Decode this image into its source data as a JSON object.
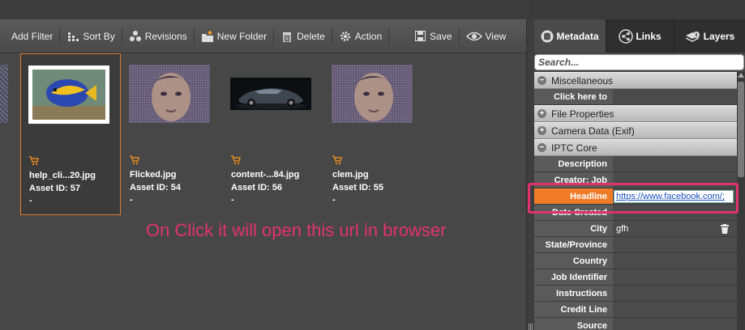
{
  "toolbar": {
    "items": [
      {
        "label": "Add Filter",
        "icon": "filter-icon"
      },
      {
        "label": "Sort By",
        "icon": "sort-icon"
      },
      {
        "label": "Revisions",
        "icon": "revisions-icon"
      },
      {
        "label": "New Folder",
        "icon": "new-folder-icon"
      },
      {
        "label": "Delete",
        "icon": "trash-icon"
      },
      {
        "label": "Action",
        "icon": "gear-icon"
      },
      {
        "label": "Save",
        "icon": "save-icon"
      },
      {
        "label": "View",
        "icon": "eye-icon"
      }
    ]
  },
  "assets": [
    {
      "name": "help_cli...20.jpg",
      "asset_id": "Asset ID: 57",
      "extra": "-",
      "thumb": "fish"
    },
    {
      "name": "Flicked.jpg",
      "asset_id": "Asset ID: 54",
      "extra": "-",
      "thumb": "portrait"
    },
    {
      "name": "content-...84.jpg",
      "asset_id": "Asset ID: 56",
      "extra": "-",
      "thumb": "car"
    },
    {
      "name": "clem.jpg",
      "asset_id": "Asset ID: 55",
      "extra": "-",
      "thumb": "portrait"
    }
  ],
  "annotation": "On Click it will open this url in browser",
  "panel": {
    "tabs": [
      {
        "label": "Metadata",
        "icon": "database-icon",
        "active": true
      },
      {
        "label": "Links",
        "icon": "share-icon",
        "active": false
      },
      {
        "label": "Layers",
        "icon": "layers-icon",
        "active": false
      }
    ],
    "search_placeholder": "Search...",
    "sections": {
      "misc": "Miscellaneous",
      "file": "File Properties",
      "camera": "Camera Data (Exif)",
      "iptc": "IPTC Core"
    },
    "misc_rows": [
      {
        "label": "Click here to",
        "value": ""
      }
    ],
    "iptc_rows": [
      {
        "label": "Description",
        "value": ""
      },
      {
        "label": "Creator: Job",
        "value": ""
      },
      {
        "label": "Headline",
        "value": "https://www.facebook.com/;"
      },
      {
        "label": "Date Created",
        "value": ""
      },
      {
        "label": "City",
        "value": "gfh"
      },
      {
        "label": "State/Province",
        "value": ""
      },
      {
        "label": "Country",
        "value": ""
      },
      {
        "label": "Job Identifier",
        "value": ""
      },
      {
        "label": "Instructions",
        "value": ""
      },
      {
        "label": "Credit Line",
        "value": ""
      },
      {
        "label": "Source",
        "value": ""
      }
    ]
  },
  "colors": {
    "accent": "#f07c2a",
    "annotation": "#e0336e",
    "link": "#1a4fc0"
  }
}
